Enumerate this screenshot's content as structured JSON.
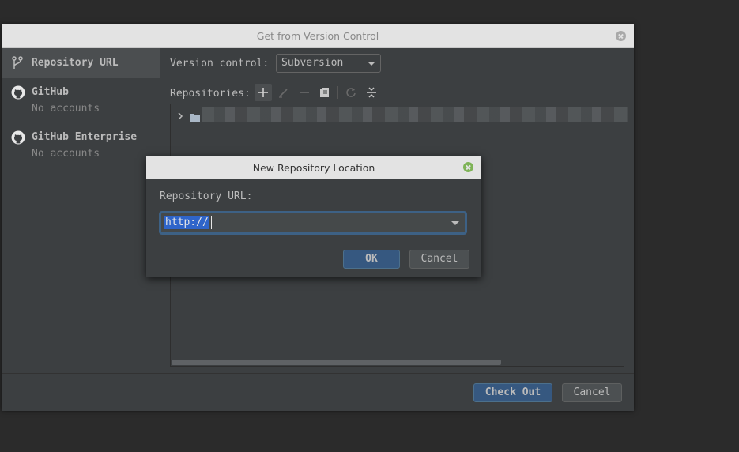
{
  "main_dialog": {
    "title": "Get from Version Control",
    "sidebar": {
      "items": [
        {
          "label": "Repository URL",
          "icon": "vcs-branch-icon",
          "selected": true
        },
        {
          "label": "GitHub",
          "sublabel": "No accounts",
          "icon": "github-icon"
        },
        {
          "label": "GitHub Enterprise",
          "sublabel": "No accounts",
          "icon": "github-icon"
        }
      ]
    },
    "version_control": {
      "label": "Version control:",
      "value": "Subversion"
    },
    "repositories": {
      "label": "Repositories:",
      "toolbar": [
        "add-icon",
        "edit-icon",
        "remove-icon",
        "browse-icon",
        "refresh-icon",
        "collapse-all-icon"
      ]
    },
    "footer": {
      "checkout_label": "Check Out",
      "cancel_label": "Cancel"
    }
  },
  "overlay_dialog": {
    "title": "New Repository Location",
    "url_label": "Repository URL:",
    "url_value": "http://",
    "ok_label": "OK",
    "cancel_label": "Cancel"
  },
  "colors": {
    "dialog_bg": "#3c3f41",
    "titlebar_bg": "#e3e3e3",
    "primary_button": "#365880",
    "focus_ring": "#3d6185",
    "selection": "#2f65ca",
    "close_green": "#7eb357"
  }
}
